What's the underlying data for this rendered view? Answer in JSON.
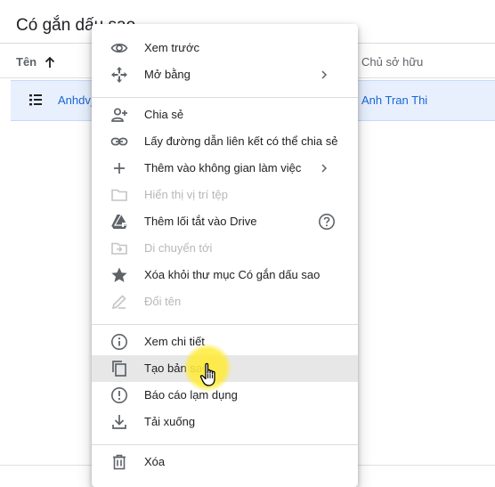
{
  "page": {
    "title": "Có gắn dấu sao",
    "columns": {
      "name": "Tên",
      "owner": "Chủ sở hữu"
    },
    "selected_file": {
      "name": "Anhdv_",
      "owner": "Anh Tran Thi"
    }
  },
  "menu": {
    "items": [
      {
        "label": "Xem trước",
        "icon": "eye-icon",
        "enabled": true
      },
      {
        "label": "Mở bằng",
        "icon": "move-arrows-icon",
        "enabled": true,
        "submenu": true
      },
      {
        "label": "Chia sẻ",
        "icon": "person-add-icon",
        "enabled": true
      },
      {
        "label": "Lấy đường dẫn liên kết có thể chia sẻ",
        "icon": "link-icon",
        "enabled": true
      },
      {
        "label": "Thêm vào không gian làm việc",
        "icon": "plus-icon",
        "enabled": true,
        "submenu": true
      },
      {
        "label": "Hiển thị vị trí tệp",
        "icon": "folder-icon",
        "enabled": false
      },
      {
        "label": "Thêm lối tắt vào Drive",
        "icon": "drive-shortcut-icon",
        "enabled": true,
        "help": true
      },
      {
        "label": "Di chuyển tới",
        "icon": "move-to-folder-icon",
        "enabled": false
      },
      {
        "label": "Xóa khỏi thư mục Có gắn dấu sao",
        "icon": "star-icon",
        "enabled": true
      },
      {
        "label": "Đổi tên",
        "icon": "pencil-icon",
        "enabled": false
      },
      {
        "label": "Xem chi tiết",
        "icon": "info-icon",
        "enabled": true
      },
      {
        "label": "Tạo bản sao",
        "icon": "copy-icon",
        "enabled": true,
        "hovered": true
      },
      {
        "label": "Báo cáo lạm dụng",
        "icon": "report-icon",
        "enabled": true
      },
      {
        "label": "Tải xuống",
        "icon": "download-icon",
        "enabled": true
      },
      {
        "label": "Xóa",
        "icon": "trash-icon",
        "enabled": true
      }
    ]
  },
  "colors": {
    "accent": "#1967d2",
    "selected_row": "#e8f0fe",
    "hover": "#e7e7e7",
    "cursor_highlight": "#ffeb3b"
  }
}
